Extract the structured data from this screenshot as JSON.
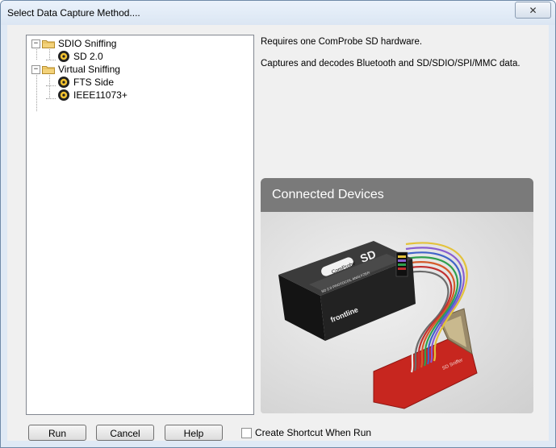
{
  "window": {
    "title": "Select Data Capture Method....",
    "close_glyph": "✕"
  },
  "tree": {
    "groups": [
      {
        "label": "SDIO Sniffing",
        "expander": "−",
        "icon": "folder-icon",
        "children": [
          {
            "label": "SD 2.0",
            "icon": "comprobe-icon"
          }
        ]
      },
      {
        "label": "Virtual Sniffing",
        "expander": "−",
        "icon": "folder-icon",
        "children": [
          {
            "label": "FTS Side",
            "icon": "comprobe-icon"
          },
          {
            "label": "IEEE11073+",
            "icon": "comprobe-icon"
          }
        ]
      }
    ]
  },
  "description": {
    "line1": "Requires one ComProbe SD hardware.",
    "line2": "Captures and decodes Bluetooth and SD/SDIO/SPI/MMC data."
  },
  "panel": {
    "header": "Connected Devices",
    "device_brand": "frontline",
    "device_logo_text": "ComProbe",
    "device_model": "SD",
    "device_subtitle": "SD 2.0 PROTOCOL ANALYZER",
    "board_label": "SD Sniffer"
  },
  "buttons": {
    "run": "Run",
    "cancel": "Cancel",
    "help": "Help"
  },
  "shortcut": {
    "label": "Create Shortcut When Run",
    "checked": false
  },
  "colors": {
    "panel_header": "#7a7a7a",
    "device_body": "#1c1c1c",
    "board_red": "#c7261f"
  }
}
